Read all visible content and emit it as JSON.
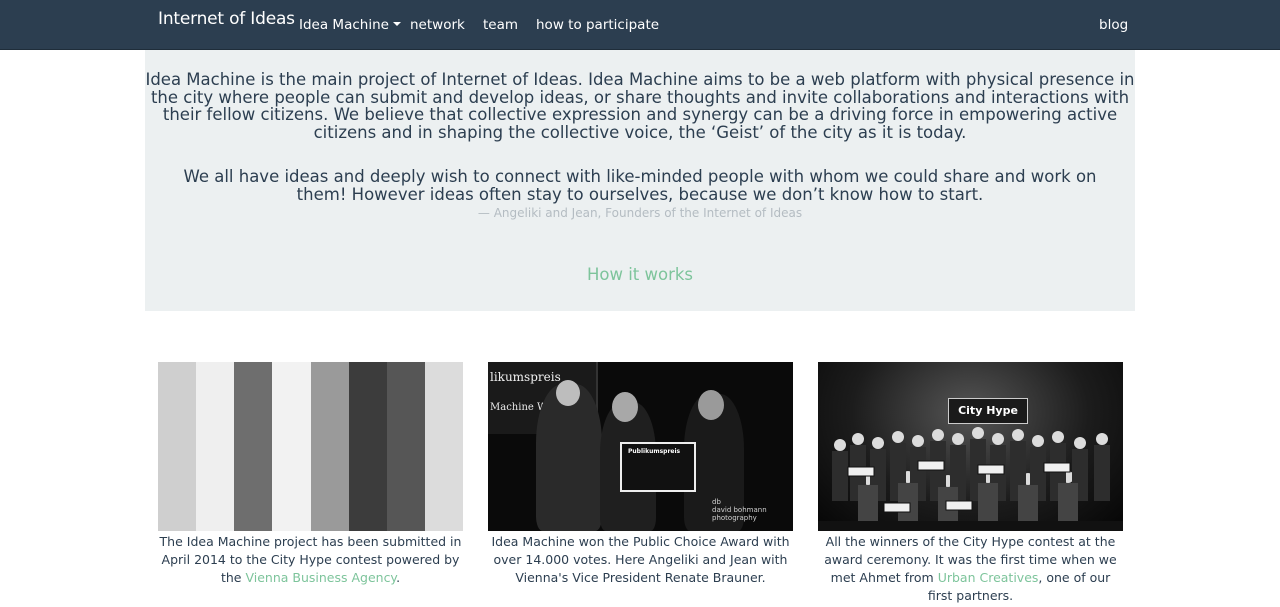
{
  "nav": {
    "brand": "Internet of Ideas",
    "items": [
      {
        "label": "Idea Machine"
      },
      {
        "label": "network"
      },
      {
        "label": "team"
      },
      {
        "label": "how to participate"
      }
    ],
    "blog": "blog"
  },
  "jumbotron": {
    "intro": "Idea Machine is the main project of Internet of Ideas. Idea Machine aims to be a web platform with physical presence in the city where people can submit and develop ideas, or share thoughts and invite collaborations and interactions with their fellow citizens. We believe that collective expression and synergy can be a driving force in empowering active citizens and in shaping the collective voice, the ‘Geist’ of the city as it is today.",
    "quote": "We all have ideas and deeply wish to connect with like-minded people with whom we could share and work on them! However ideas often stay to ourselves, because we don’t know how to start.",
    "attribution": "— Angeliki and Jean, Founders of the Internet of Ideas",
    "how_link": "How it works"
  },
  "photo2": {
    "banner": "likumspreis",
    "banner_sub": "Machine Wi",
    "sign_title": "Publikumspreis",
    "watermark_1": "db",
    "watermark_2": "david bohmann",
    "watermark_3": "photography"
  },
  "photo3": {
    "logo": "City Hype"
  },
  "columns": [
    {
      "caption_pre": "The Idea Machine project has been submitted in April 2014 to the City Hype contest powered by the ",
      "link": "Vienna Business Agency",
      "caption_post": "."
    },
    {
      "caption_pre": "Idea Machine won the Public Choice Award with over 14.000 votes. Here Angeliki and Jean with Vienna's Vice President Renate Brauner.",
      "link": "",
      "caption_post": ""
    },
    {
      "caption_pre": "All the winners of the City Hype contest at the award ceremony. It was the first time when we met Ahmet from ",
      "link": "Urban Creatives",
      "caption_post": ", one of our first partners."
    }
  ],
  "colors": {
    "navbar": "#2c3e50",
    "jumbotron": "#ecf0f1",
    "link": "#7dc49b",
    "muted": "#b4bcc2"
  }
}
